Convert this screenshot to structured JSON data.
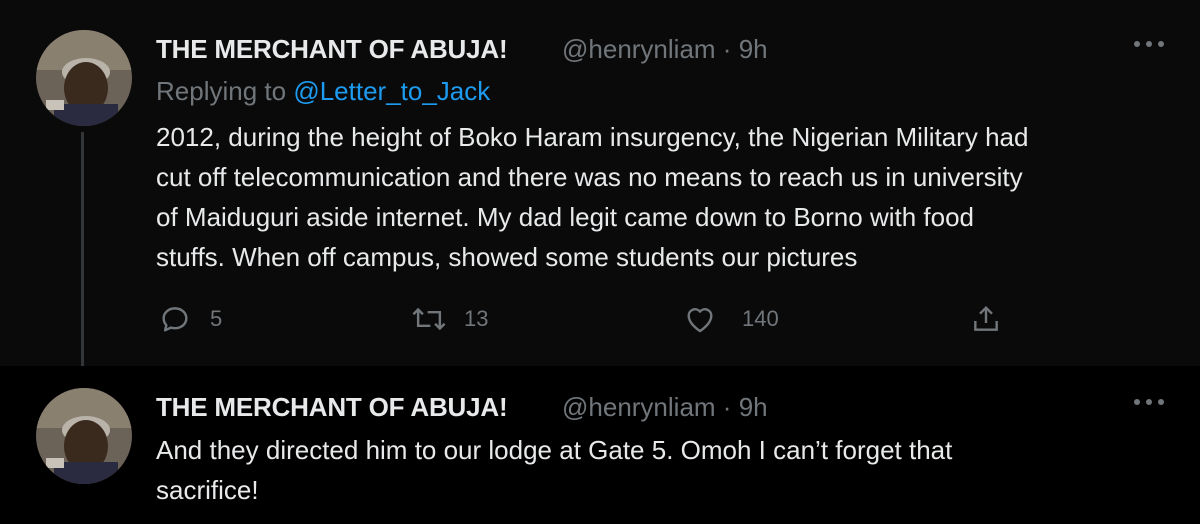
{
  "tweets": [
    {
      "display_name": "THE MERCHANT OF ABUJA!",
      "handle": "@henrynliam",
      "separator": "·",
      "time": "9h",
      "replying_prefix": "Replying to",
      "replying_to": "@Letter_to_Jack",
      "body": "2012, during the height of Boko Haram insurgency, the Nigerian Military had\ncut off telecommunication and there was no means to reach us in university\nof Maiduguri aside internet. My dad legit came down to Borno with food\nstuffs. When off campus, showed some students our pictures",
      "actions": {
        "reply_icon": "speech-bubble-icon",
        "reply_count": "5",
        "retweet_icon": "retweet-arrows-icon",
        "retweet_count": "13",
        "like_icon": "heart-icon",
        "like_count": "140",
        "share_icon": "share-upload-icon"
      }
    },
    {
      "display_name": "THE MERCHANT OF ABUJA!",
      "handle": "@henrynliam",
      "separator": "·",
      "time": "9h",
      "body": "And they directed him to our lodge at Gate 5. Omoh I can’t forget that\nsacrifice!"
    }
  ],
  "more_icon": "more-dots-icon",
  "colors": {
    "background": "#000000",
    "text": "#e7e9ea",
    "secondary": "#71767b",
    "link": "#1d9bf0",
    "thread_line": "#333639"
  }
}
